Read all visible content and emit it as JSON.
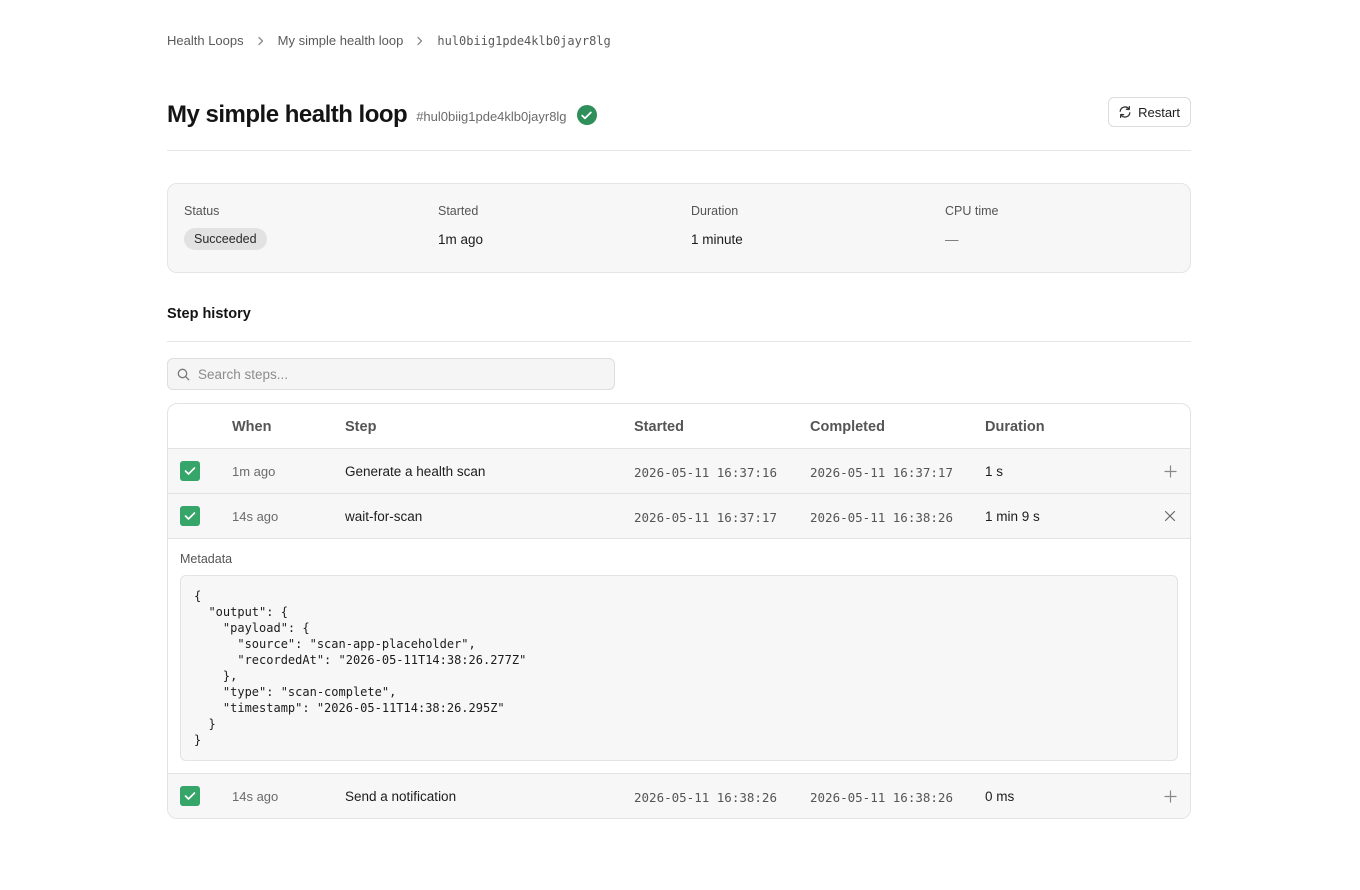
{
  "breadcrumb": {
    "items": [
      "Health Loops",
      "My simple health loop"
    ],
    "current": "hul0biig1pde4klb0jayr8lg"
  },
  "header": {
    "title": "My simple health loop",
    "run_id": "#hul0biig1pde4klb0jayr8lg",
    "restart_label": "Restart"
  },
  "summary": {
    "status_label": "Status",
    "status_value": "Succeeded",
    "started_label": "Started",
    "started_value": "1m ago",
    "duration_label": "Duration",
    "duration_value": "1 minute",
    "cpu_label": "CPU time",
    "cpu_value": "—"
  },
  "step_history": {
    "title": "Step history",
    "search_placeholder": "Search steps...",
    "columns": {
      "when": "When",
      "step": "Step",
      "started": "Started",
      "completed": "Completed",
      "duration": "Duration"
    },
    "rows": [
      {
        "when": "1m ago",
        "step": "Generate a health scan",
        "started": "2026-05-11 16:37:16",
        "completed": "2026-05-11 16:37:17",
        "duration": "1 s",
        "action": "expand-icon"
      },
      {
        "when": "14s ago",
        "step": "wait-for-scan",
        "started": "2026-05-11 16:37:17",
        "completed": "2026-05-11 16:38:26",
        "duration": "1 min 9 s",
        "action": "collapse-icon"
      },
      {
        "when": "14s ago",
        "step": "Send a notification",
        "started": "2026-05-11 16:38:26",
        "completed": "2026-05-11 16:38:26",
        "duration": "0 ms",
        "action": "expand-icon"
      }
    ],
    "metadata_label": "Metadata",
    "metadata_json": "{\n  \"output\": {\n    \"payload\": {\n      \"source\": \"scan-app-placeholder\",\n      \"recordedAt\": \"2026-05-11T14:38:26.277Z\"\n    },\n    \"type\": \"scan-complete\",\n    \"timestamp\": \"2026-05-11T14:38:26.295Z\"\n  }\n}"
  },
  "colors": {
    "success": "#2f8f5b",
    "checkbox": "#36a56a"
  }
}
